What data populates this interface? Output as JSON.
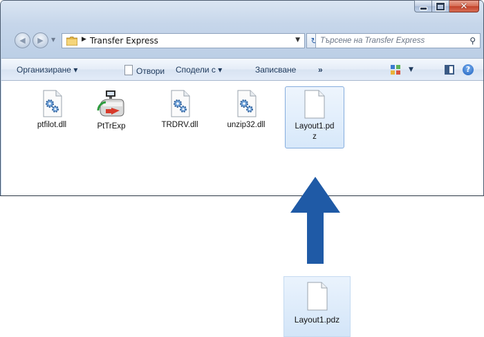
{
  "window": {
    "caption_buttons": {
      "minimize": "minimize",
      "maximize": "maximize",
      "close": "✕"
    }
  },
  "address_bar": {
    "breadcrumb": "Transfer Express",
    "search_placeholder": "Търсене на Transfer Express"
  },
  "command_bar": {
    "organize": "Организиране ▾",
    "open": "Отвори",
    "share": "Сподели с ▾",
    "burn": "Записване",
    "more": "»"
  },
  "files": [
    {
      "name": "ptfilot.dll",
      "icon": "dll-gear-icon"
    },
    {
      "name": "PtTrExp",
      "icon": "app-transfer-icon"
    },
    {
      "name": "TRDRV.dll",
      "icon": "dll-gear-icon"
    },
    {
      "name": "unzip32.dll",
      "icon": "dll-gear-icon"
    },
    {
      "name_line1": "Layout1.pd",
      "name_line2": "z",
      "icon": "blank-file-icon",
      "selected": true
    }
  ],
  "dragged_file": {
    "name": "Layout1.pdz",
    "icon": "blank-file-icon"
  },
  "colors": {
    "arrow": "#1f5aa6",
    "selection": "#d7e8fa"
  }
}
